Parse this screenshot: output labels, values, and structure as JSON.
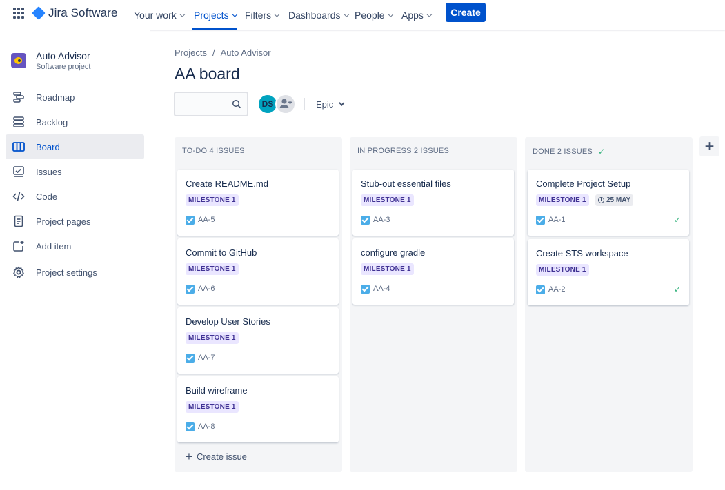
{
  "topnav": {
    "logo_text": "Jira Software",
    "items": [
      {
        "label": "Your work"
      },
      {
        "label": "Projects"
      },
      {
        "label": "Filters"
      },
      {
        "label": "Dashboards"
      },
      {
        "label": "People"
      },
      {
        "label": "Apps"
      }
    ],
    "active_item": "Projects",
    "create_label": "Create",
    "brand_color": "#0052cc"
  },
  "sidebar": {
    "project_name": "Auto Advisor",
    "project_type": "Software project",
    "items": [
      {
        "label": "Roadmap",
        "icon": "roadmap-icon"
      },
      {
        "label": "Backlog",
        "icon": "backlog-icon"
      },
      {
        "label": "Board",
        "icon": "board-icon"
      },
      {
        "label": "Issues",
        "icon": "issues-icon"
      },
      {
        "label": "Code",
        "icon": "code-icon"
      },
      {
        "label": "Project pages",
        "icon": "pages-icon"
      },
      {
        "label": "Add item",
        "icon": "add-item-icon"
      },
      {
        "label": "Project settings",
        "icon": "settings-icon"
      }
    ],
    "active_item": "Board"
  },
  "breadcrumb": {
    "root": "Projects",
    "separator": "/",
    "current": "Auto Advisor"
  },
  "page_title": "AA board",
  "toolbar": {
    "search_value": "",
    "avatar_initials": "DS",
    "epic_label": "Epic"
  },
  "columns": [
    {
      "header": "TO-DO 4 ISSUES",
      "cards": [
        {
          "title": "Create README.md",
          "badge": "MILESTONE 1",
          "key": "AA-5"
        },
        {
          "title": "Commit to GitHub",
          "badge": "MILESTONE 1",
          "key": "AA-6"
        },
        {
          "title": "Develop User Stories",
          "badge": "MILESTONE 1",
          "key": "AA-7"
        },
        {
          "title": "Build wireframe",
          "badge": "MILESTONE 1",
          "key": "AA-8"
        }
      ],
      "create_issue_label": "Create issue"
    },
    {
      "header": "IN PROGRESS 2 ISSUES",
      "cards": [
        {
          "title": "Stub-out essential files",
          "badge": "MILESTONE 1",
          "key": "AA-3"
        },
        {
          "title": "configure gradle",
          "badge": "MILESTONE 1",
          "key": "AA-4"
        }
      ]
    },
    {
      "header": "DONE 2 ISSUES",
      "cards": [
        {
          "title": "Complete Project Setup",
          "badge": "MILESTONE 1",
          "key": "AA-1",
          "due": "25 MAY"
        },
        {
          "title": "Create STS workspace",
          "badge": "MILESTONE 1",
          "key": "AA-2"
        }
      ]
    }
  ]
}
